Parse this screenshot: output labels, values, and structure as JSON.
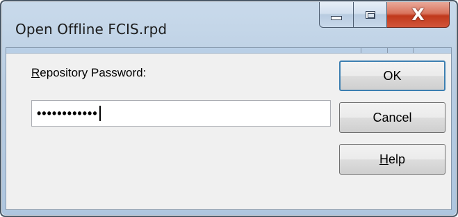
{
  "window": {
    "title": "Open Offline FCIS.rpd",
    "close_glyph": "X"
  },
  "form": {
    "password_label_accesskey": "R",
    "password_label_rest": "epository Password:",
    "password_value": "••••••••••••"
  },
  "buttons": {
    "ok": "OK",
    "cancel": "Cancel",
    "help_accesskey": "H",
    "help_rest": "elp"
  }
}
